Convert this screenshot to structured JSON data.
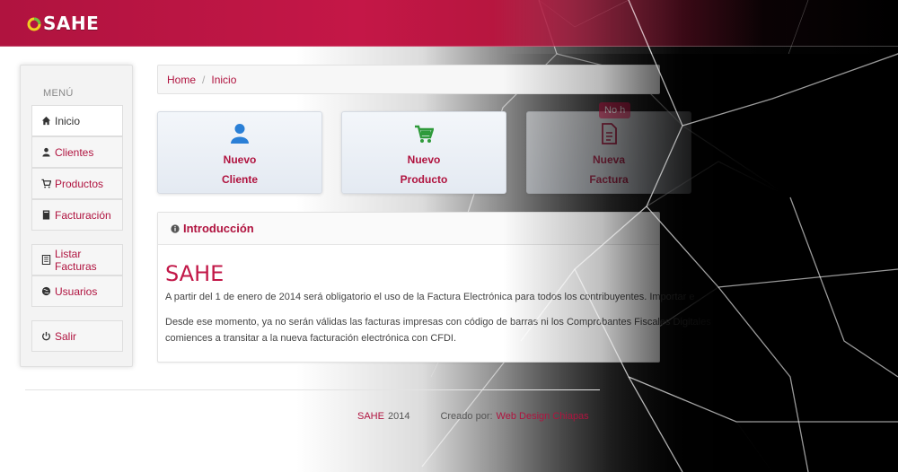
{
  "brand": {
    "name": "SAHE"
  },
  "sidebar": {
    "menu_label": "MENÚ",
    "items": [
      {
        "label": "Inicio",
        "icon": "home-icon"
      },
      {
        "label": "Clientes",
        "icon": "user-icon"
      },
      {
        "label": "Productos",
        "icon": "cart-icon"
      },
      {
        "label": "Facturación",
        "icon": "book-icon"
      },
      {
        "label": "Listar Facturas",
        "icon": "list-icon"
      },
      {
        "label": "Usuarios",
        "icon": "globe-icon"
      },
      {
        "label": "Salir",
        "icon": "power-icon"
      }
    ]
  },
  "breadcrumb": {
    "home": "Home",
    "separator": "/",
    "current": "Inicio"
  },
  "tiles": [
    {
      "line1": "Nuevo",
      "line2": "Cliente",
      "icon": "user-icon"
    },
    {
      "line1": "Nuevo",
      "line2": "Producto",
      "icon": "cart-icon"
    },
    {
      "line1": "Nueva",
      "line2": "Factura",
      "icon": "document-icon"
    }
  ],
  "badge": {
    "label": "No h"
  },
  "intro": {
    "panel_title": "Introducción",
    "heading": "SAHE",
    "p1": "A partir del 1 de enero de 2014 será obligatorio el uso de la Factura Electrónica para todos los contribuyentes. Importar e",
    "p2": "Desde ese momento, ya no serán válidas las facturas impresas con código de barras ni los Comprobantes Fiscales Digitales",
    "p3": "comiences a transitar a la nueva facturación electrónica con CFDI."
  },
  "footer": {
    "brand": "SAHE",
    "year": "2014",
    "created_by": "Creado por:",
    "author": "Web Design Chiapas"
  },
  "colors": {
    "accent": "#b0133f",
    "topbar": "#c41747"
  }
}
